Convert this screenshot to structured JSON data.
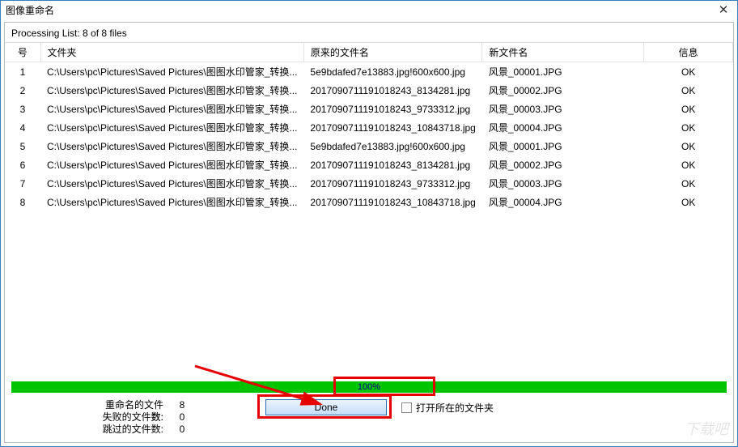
{
  "window": {
    "title": "图像重命名",
    "close": "✕"
  },
  "processing_label": "Processing List: 8 of 8 files",
  "columns": {
    "num": "号",
    "folder": "文件夹",
    "old_name": "原来的文件名",
    "new_name": "新文件名",
    "info": "信息"
  },
  "rows": [
    {
      "num": "1",
      "folder": "C:\\Users\\pc\\Pictures\\Saved Pictures\\图图水印管家_转换...",
      "old": "5e9bdafed7e13883.jpg!600x600.jpg",
      "new": "风景_00001.JPG",
      "info": "OK"
    },
    {
      "num": "2",
      "folder": "C:\\Users\\pc\\Pictures\\Saved Pictures\\图图水印管家_转换...",
      "old": "20170907111910182​43_8134281.jpg",
      "new": "风景_00002.JPG",
      "info": "OK"
    },
    {
      "num": "3",
      "folder": "C:\\Users\\pc\\Pictures\\Saved Pictures\\图图水印管家_转换...",
      "old": "20170907111910182​43_9733312.jpg",
      "new": "风景_00003.JPG",
      "info": "OK"
    },
    {
      "num": "4",
      "folder": "C:\\Users\\pc\\Pictures\\Saved Pictures\\图图水印管家_转换...",
      "old": "20170907111910182​43_10843718.jpg",
      "new": "风景_00004.JPG",
      "info": "OK"
    },
    {
      "num": "5",
      "folder": "C:\\Users\\pc\\Pictures\\Saved Pictures\\图图水印管家_转换...",
      "old": "5e9bdafed7e13883.jpg!600x600.jpg",
      "new": "风景_00001.JPG",
      "info": "OK"
    },
    {
      "num": "6",
      "folder": "C:\\Users\\pc\\Pictures\\Saved Pictures\\图图水印管家_转换...",
      "old": "20170907111910182​43_8134281.jpg",
      "new": "风景_00002.JPG",
      "info": "OK"
    },
    {
      "num": "7",
      "folder": "C:\\Users\\pc\\Pictures\\Saved Pictures\\图图水印管家_转换...",
      "old": "20170907111910182​43_9733312.jpg",
      "new": "风景_00003.JPG",
      "info": "OK"
    },
    {
      "num": "8",
      "folder": "C:\\Users\\pc\\Pictures\\Saved Pictures\\图图水印管家_转换...",
      "old": "20170907111910182​43_10843718.jpg",
      "new": "风景_00004.JPG",
      "info": "OK"
    }
  ],
  "progress": {
    "percent": "100%"
  },
  "stats": {
    "renamed_label": "重命名的文件数:",
    "renamed_val": "8",
    "failed_label": "失败的文件数:",
    "failed_val": "0",
    "skipped_label": "跳过的文件数:",
    "skipped_val": "0"
  },
  "buttons": {
    "done": "Done"
  },
  "checkbox": {
    "label": "打开所在的文件夹"
  },
  "watermark": "下载吧"
}
